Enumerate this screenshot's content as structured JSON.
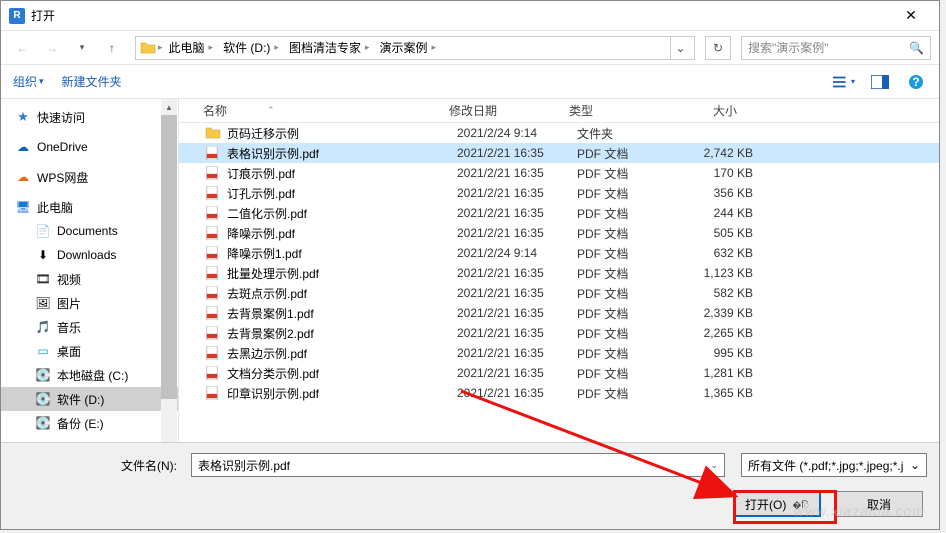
{
  "titlebar": {
    "title": "打开"
  },
  "breadcrumb": {
    "segments": [
      "此电脑",
      "软件 (D:)",
      "图档清洁专家",
      "演示案例"
    ]
  },
  "search": {
    "placeholder": "搜索\"演示案例\""
  },
  "toolbar": {
    "organize": "组织",
    "newfolder": "新建文件夹"
  },
  "sidebar": {
    "quick": "快速访问",
    "onedrive": "OneDrive",
    "wps": "WPS网盘",
    "pc": "此电脑",
    "documents": "Documents",
    "downloads": "Downloads",
    "videos": "视频",
    "pictures": "图片",
    "music": "音乐",
    "desktop": "桌面",
    "diskC": "本地磁盘 (C:)",
    "diskD": "软件 (D:)",
    "diskE": "备份 (E:)"
  },
  "columns": {
    "name": "名称",
    "date": "修改日期",
    "type": "类型",
    "size": "大小"
  },
  "files": [
    {
      "icon": "folder",
      "name": "页码迁移示例",
      "date": "2021/2/24 9:14",
      "type": "文件夹",
      "size": ""
    },
    {
      "icon": "pdf",
      "name": "表格识别示例.pdf",
      "date": "2021/2/21 16:35",
      "type": "PDF 文档",
      "size": "2,742 KB",
      "selected": true
    },
    {
      "icon": "pdf",
      "name": "订痕示例.pdf",
      "date": "2021/2/21 16:35",
      "type": "PDF 文档",
      "size": "170 KB"
    },
    {
      "icon": "pdf",
      "name": "订孔示例.pdf",
      "date": "2021/2/21 16:35",
      "type": "PDF 文档",
      "size": "356 KB"
    },
    {
      "icon": "pdf",
      "name": "二值化示例.pdf",
      "date": "2021/2/21 16:35",
      "type": "PDF 文档",
      "size": "244 KB"
    },
    {
      "icon": "pdf",
      "name": "降噪示例.pdf",
      "date": "2021/2/21 16:35",
      "type": "PDF 文档",
      "size": "505 KB"
    },
    {
      "icon": "pdf",
      "name": "降噪示例1.pdf",
      "date": "2021/2/24 9:14",
      "type": "PDF 文档",
      "size": "632 KB"
    },
    {
      "icon": "pdf",
      "name": "批量处理示例.pdf",
      "date": "2021/2/21 16:35",
      "type": "PDF 文档",
      "size": "1,123 KB"
    },
    {
      "icon": "pdf",
      "name": "去斑点示例.pdf",
      "date": "2021/2/21 16:35",
      "type": "PDF 文档",
      "size": "582 KB"
    },
    {
      "icon": "pdf",
      "name": "去背景案例1.pdf",
      "date": "2021/2/21 16:35",
      "type": "PDF 文档",
      "size": "2,339 KB"
    },
    {
      "icon": "pdf",
      "name": "去背景案例2.pdf",
      "date": "2021/2/21 16:35",
      "type": "PDF 文档",
      "size": "2,265 KB"
    },
    {
      "icon": "pdf",
      "name": "去黑边示例.pdf",
      "date": "2021/2/21 16:35",
      "type": "PDF 文档",
      "size": "995 KB"
    },
    {
      "icon": "pdf",
      "name": "文档分类示例.pdf",
      "date": "2021/2/21 16:35",
      "type": "PDF 文档",
      "size": "1,281 KB"
    },
    {
      "icon": "pdf",
      "name": "印章识别示例.pdf",
      "date": "2021/2/21 16:35",
      "type": "PDF 文档",
      "size": "1,365 KB"
    }
  ],
  "footer": {
    "filename_label": "文件名(N):",
    "filename_value": "表格识别示例.pdf",
    "filter": "所有文件 (*.pdf;*.jpg;*.jpeg;*.j",
    "open": "打开(O)",
    "cancel": "取消"
  },
  "watermark": "www.xiazaiba.com"
}
